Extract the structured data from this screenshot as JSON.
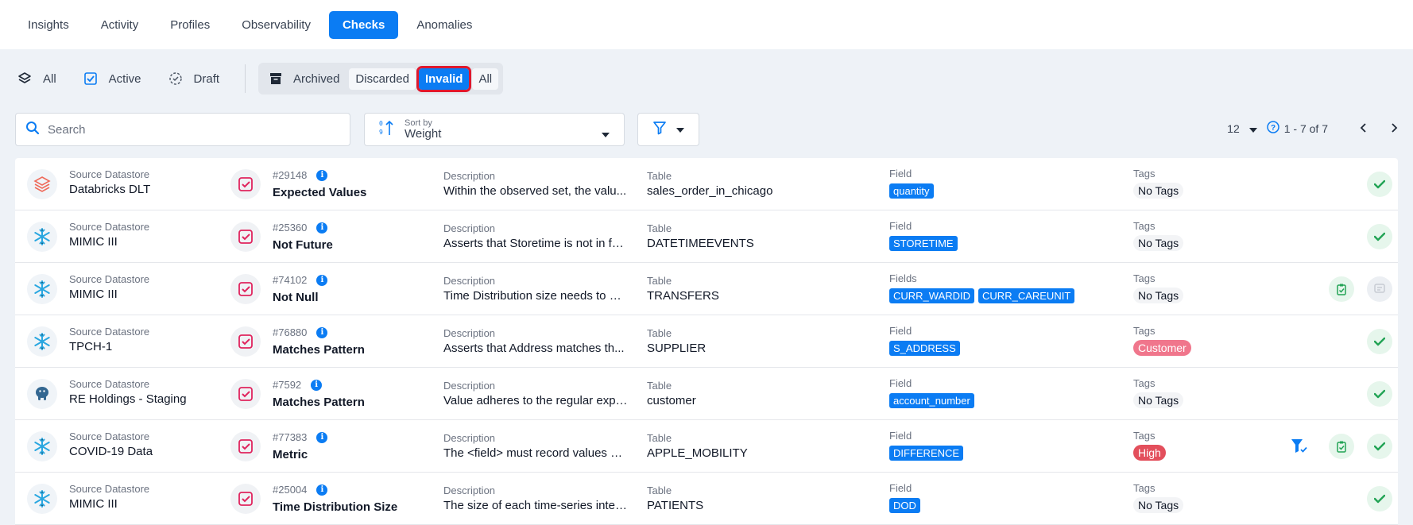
{
  "top_tabs": [
    "Insights",
    "Activity",
    "Profiles",
    "Observability",
    "Checks",
    "Anomalies"
  ],
  "active_top_tab": "Checks",
  "status_filters": {
    "all": "All",
    "active": "Active",
    "draft": "Draft",
    "archived": "Archived",
    "discarded": "Discarded",
    "invalid": "Invalid",
    "archived_all": "All"
  },
  "search": {
    "placeholder": "Search"
  },
  "sort": {
    "caption": "Sort by",
    "value": "Weight"
  },
  "pager": {
    "per_page": "12",
    "range": "1 - 7 of 7"
  },
  "colors": {
    "accent": "#0b7cf3",
    "highlight": "#e0182d",
    "valid": "#22a355",
    "tag_customer": "#f0768c",
    "tag_high": "#e34f5c"
  },
  "labels": {
    "source_datastore": "Source Datastore",
    "description": "Description",
    "table": "Table",
    "field": "Field",
    "fields": "Fields",
    "tags": "Tags"
  },
  "rows": [
    {
      "datastore_icon": "databricks-icon",
      "datastore": "Databricks DLT",
      "id": "#29148",
      "check": "Expected Values",
      "description": "Within the observed set, the valu...",
      "table": "sales_order_in_chicago",
      "field_label": "Field",
      "fields": [
        "quantity"
      ],
      "tag": "No Tags",
      "tag_style": "plain",
      "actions": [
        "valid"
      ]
    },
    {
      "datastore_icon": "snowflake-icon",
      "datastore": "MIMIC III",
      "id": "#25360",
      "check": "Not Future",
      "description": "Asserts that Storetime is not in fu...",
      "table": "DATETIMEEVENTS",
      "field_label": "Field",
      "fields": [
        "STORETIME"
      ],
      "tag": "No Tags",
      "tag_style": "plain",
      "actions": [
        "valid"
      ]
    },
    {
      "datastore_icon": "snowflake-icon",
      "datastore": "MIMIC III",
      "id": "#74102",
      "check": "Not Null",
      "description": "Time Distribution size needs to be...",
      "table": "TRANSFERS",
      "field_label": "Fields",
      "fields": [
        "CURR_WARDID",
        "CURR_CAREUNIT"
      ],
      "tag": "No Tags",
      "tag_style": "plain",
      "actions": [
        "clipboard",
        "comment"
      ]
    },
    {
      "datastore_icon": "snowflake-icon",
      "datastore": "TPCH-1",
      "id": "#76880",
      "check": "Matches Pattern",
      "description": "Asserts that Address matches th...",
      "table": "SUPPLIER",
      "field_label": "Field",
      "fields": [
        "S_ADDRESS"
      ],
      "tag": "Customer",
      "tag_style": "pink",
      "actions": [
        "valid"
      ]
    },
    {
      "datastore_icon": "postgres-icon",
      "datastore": "RE Holdings - Staging",
      "id": "#7592",
      "check": "Matches Pattern",
      "description": "Value adheres to the regular expr...",
      "table": "customer",
      "field_label": "Field",
      "fields": [
        "account_number"
      ],
      "tag": "No Tags",
      "tag_style": "plain",
      "actions": [
        "valid"
      ]
    },
    {
      "datastore_icon": "snowflake-icon",
      "datastore": "COVID-19 Data",
      "id": "#77383",
      "check": "Metric",
      "description": "The <field> must record values du...",
      "table": "APPLE_MOBILITY",
      "field_label": "Field",
      "fields": [
        "DIFFERENCE"
      ],
      "tag": "High",
      "tag_style": "red",
      "actions": [
        "funnel",
        "clipboard",
        "valid"
      ]
    },
    {
      "datastore_icon": "snowflake-icon",
      "datastore": "MIMIC III",
      "id": "#25004",
      "check": "Time Distribution Size",
      "description": "The size of each time-series inter...",
      "table": "PATIENTS",
      "field_label": "Field",
      "fields": [
        "DOD"
      ],
      "tag": "No Tags",
      "tag_style": "plain",
      "actions": [
        "valid"
      ]
    }
  ]
}
